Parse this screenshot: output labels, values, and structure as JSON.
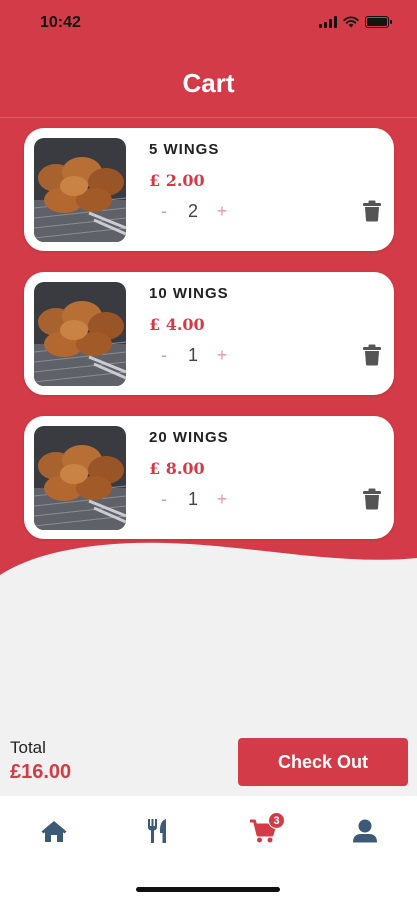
{
  "status": {
    "time": "10:42"
  },
  "header": {
    "title": "Cart"
  },
  "cart": {
    "items": [
      {
        "name": "5 WINGS",
        "price": "£ 2.00",
        "quantity": "2",
        "minus": "-",
        "plus": "+"
      },
      {
        "name": "10 WINGS",
        "price": "£ 4.00",
        "quantity": "1",
        "minus": "-",
        "plus": "+"
      },
      {
        "name": "20 WINGS",
        "price": "£ 8.00",
        "quantity": "1",
        "minus": "-",
        "plus": "+"
      }
    ]
  },
  "footer": {
    "total_label": "Total",
    "total_amount": "£16.00",
    "checkout_label": "Check Out"
  },
  "tabbar": {
    "items": [
      {
        "icon": "home-icon"
      },
      {
        "icon": "utensils-icon"
      },
      {
        "icon": "cart-icon",
        "badge": "3",
        "active": true
      },
      {
        "icon": "user-icon"
      }
    ]
  },
  "colors": {
    "accent": "#d43b48",
    "inactive_icon": "#3c5a78",
    "background": "#f1f1f1"
  }
}
